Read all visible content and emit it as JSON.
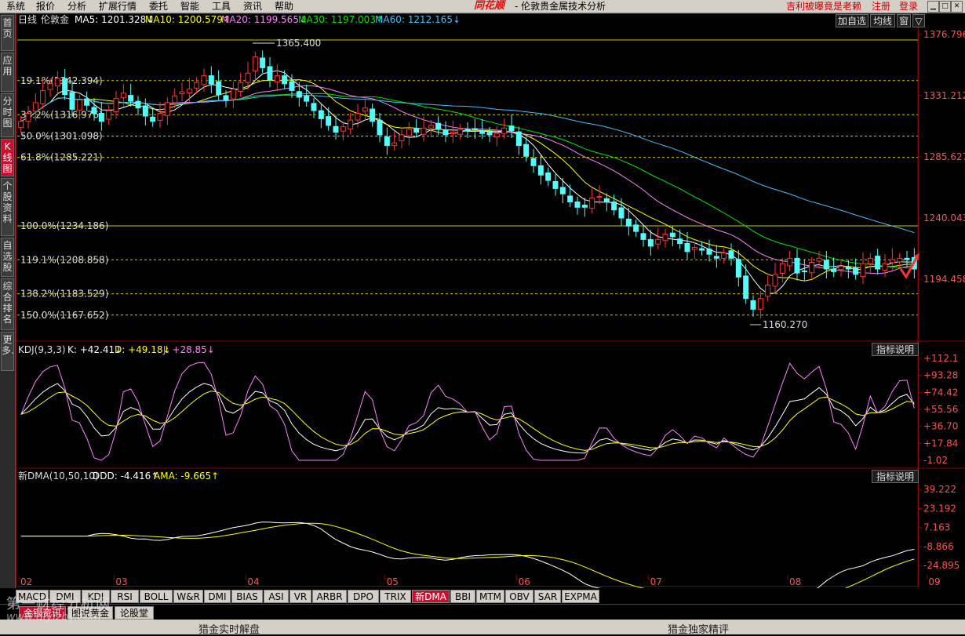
{
  "menu": [
    "系统",
    "报价",
    "分析",
    "扩展行情",
    "委托",
    "智能",
    "工具",
    "资讯",
    "帮助"
  ],
  "brand": "同花顺",
  "window_title": "- 伦敦贵金属技术分析",
  "ad_text": "吉利被曝竟是老赖",
  "register": "注册",
  "login": "登录",
  "sidebar": [
    "首页",
    "应用",
    "分时图",
    "K线图",
    "个股资料",
    "自选股",
    "综合排名",
    "更多."
  ],
  "main_panel": {
    "period": "日线",
    "symbol": "伦敦金",
    "ma5": "MA5: 1201.328↓",
    "ma10": "MA10: 1200.579↑",
    "ma20": "MA20: 1199.565↓",
    "ma30": "MA30: 1197.003↑",
    "ma60": "MA60: 1212.165↓",
    "btn_add": "加自选",
    "btn_ma": "均线",
    "btn_win": "窗",
    "btn_more": "▽",
    "y_ticks": [
      "1376.796",
      "1331.212",
      "1285.627",
      "1240.043",
      "1194.458"
    ],
    "fib": [
      {
        "label": "19.1%(1342.394)",
        "value": 1342.394
      },
      {
        "label": "38.2%(1316.976)",
        "value": 1316.976
      },
      {
        "label": "50.0%(1301.098)",
        "value": 1301.098
      },
      {
        "label": "61.8%(1285.221)",
        "value": 1285.221
      },
      {
        "label": "100.0%(1234.186)",
        "value": 1234.186
      },
      {
        "label": "119.1%(1208.858)",
        "value": 1208.858
      },
      {
        "label": "138.2%(1183.529)",
        "value": 1183.529
      },
      {
        "label": "150.0%(1167.652)",
        "value": 1167.652
      }
    ],
    "high_label": "1365.400",
    "low_label": "1160.270"
  },
  "kdj_panel": {
    "title": "KDJ(9,3,3)",
    "k": "K: +42.41↓",
    "d": "D: +49.18↓",
    "j": "J: +28.85↓",
    "btn": "指标说明",
    "y_ticks": [
      "+112.1",
      "+93.28",
      "+74.42",
      "+55.56",
      "+36.70",
      "+17.84",
      "-1.02"
    ]
  },
  "dma_panel": {
    "title": "新DMA(10,50,10)",
    "ddd": "DDD: -4.416↑",
    "ama": "AMA: -9.665↑",
    "btn": "指标说明",
    "y_ticks": [
      "39.222",
      "23.192",
      "7.163",
      "-8.866",
      "-24.895"
    ]
  },
  "x_months": [
    "02",
    "03",
    "04",
    "05",
    "06",
    "07",
    "08",
    "09"
  ],
  "indicator_tabs": [
    "MACD",
    "DMI",
    "KDJ",
    "RSI",
    "BOLL",
    "W&R",
    "DMI",
    "BIAS",
    "ASI",
    "VR",
    "ARBR",
    "DPO",
    "TRIX",
    "新DMA",
    "BBI",
    "MTM",
    "OBV",
    "SAR",
    "EXPMA"
  ],
  "news_tabs": [
    "金银资讯",
    "图说黄金",
    "论股堂"
  ],
  "bottom_left": "猎金实时解盘",
  "bottom_right": "猎金独家精评",
  "watermark": "第一财经分析网",
  "watermark_url": "www.diyizby.com",
  "colors": {
    "up": "#ff3232",
    "down": "#54fcfc",
    "ma5": "#ffffff",
    "ma10": "#ffff00",
    "ma20": "#ff80ff",
    "ma30": "#00e600",
    "ma60": "#40c0ff",
    "fib_line": "#c8c800"
  },
  "chart_data": {
    "type": "candlestick",
    "y_range": [
      1150,
      1382
    ],
    "closes": [
      1312,
      1318,
      1326,
      1335,
      1340,
      1344,
      1332,
      1321,
      1328,
      1324,
      1318,
      1312,
      1320,
      1329,
      1333,
      1327,
      1322,
      1316,
      1312,
      1318,
      1326,
      1331,
      1334,
      1336,
      1341,
      1346,
      1340,
      1332,
      1328,
      1336,
      1341,
      1348,
      1360,
      1352,
      1343,
      1346,
      1340,
      1335,
      1330,
      1327,
      1320,
      1314,
      1309,
      1304,
      1308,
      1313,
      1318,
      1322,
      1312,
      1302,
      1294,
      1296,
      1302,
      1306,
      1304,
      1307,
      1309,
      1306,
      1302,
      1304,
      1306,
      1305,
      1306,
      1303,
      1302,
      1303,
      1307,
      1305,
      1294,
      1286,
      1279,
      1272,
      1268,
      1262,
      1258,
      1252,
      1248,
      1248,
      1255,
      1256,
      1252,
      1246,
      1240,
      1234,
      1230,
      1224,
      1219,
      1224,
      1228,
      1226,
      1221,
      1215,
      1218,
      1216,
      1213,
      1210,
      1214,
      1210,
      1196,
      1180,
      1172,
      1180,
      1190,
      1198,
      1206,
      1210,
      1199,
      1200,
      1207,
      1210,
      1202,
      1200,
      1204,
      1202,
      1198,
      1206,
      1210,
      1202,
      1206,
      1209,
      1210,
      1209,
      1202
    ]
  }
}
